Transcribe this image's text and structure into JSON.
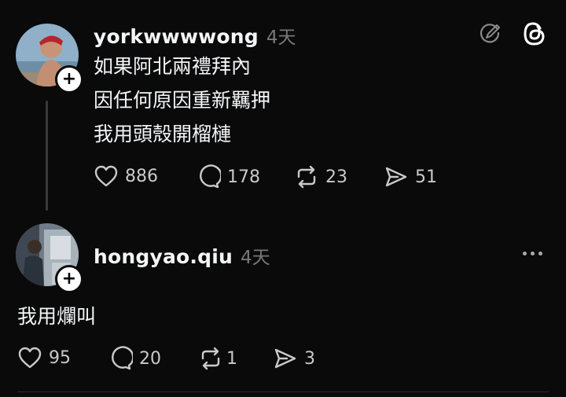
{
  "colors": {
    "background": "#0a0a0a",
    "text": "#f3f5f7",
    "muted": "#777777",
    "icon": "#c9c9c9"
  },
  "posts": [
    {
      "username": "yorkwwwwong",
      "time": "4天",
      "lines": [
        "如果阿北兩禮拜內",
        "因任何原因重新羈押",
        "我用頭殼開榴槤"
      ],
      "likes": "886",
      "comments": "178",
      "reposts": "23",
      "shares": "51"
    },
    {
      "username": "hongyao.qiu",
      "time": "4天",
      "lines": [
        "我用爛叫"
      ],
      "likes": "95",
      "comments": "20",
      "reposts": "1",
      "shares": "3"
    }
  ],
  "icons": {
    "edit": "edit-circle-icon",
    "threads": "threads-logo-icon",
    "more": "more-dots-icon",
    "like": "heart-icon",
    "comment": "comment-icon",
    "repost": "repost-icon",
    "share": "share-icon",
    "follow": "plus-icon"
  }
}
